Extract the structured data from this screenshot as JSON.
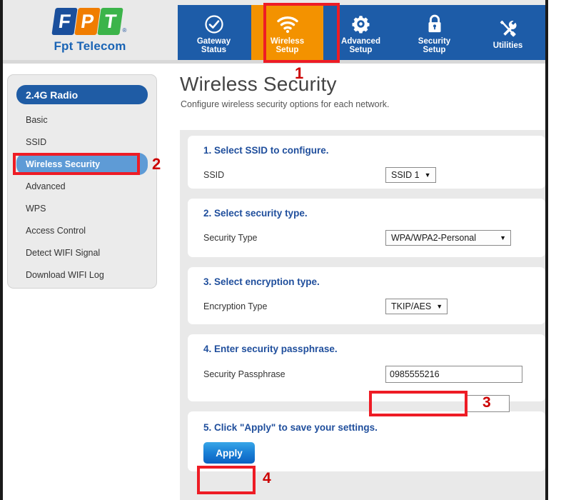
{
  "brand": {
    "letters": [
      "F",
      "P",
      "T"
    ],
    "registered": "®",
    "name": "Fpt Telecom"
  },
  "nav": {
    "items": [
      {
        "id": "gateway-status",
        "line1": "Gateway",
        "line2": "Status",
        "icon": "check-circle-icon",
        "active": false
      },
      {
        "id": "wireless-setup",
        "line1": "Wireless",
        "line2": "Setup",
        "icon": "wifi-icon",
        "active": true
      },
      {
        "id": "advanced-setup",
        "line1": "Advanced",
        "line2": "Setup",
        "icon": "gear-icon",
        "active": false
      },
      {
        "id": "security-setup",
        "line1": "Security",
        "line2": "Setup",
        "icon": "lock-icon",
        "active": false
      },
      {
        "id": "utilities",
        "line1": "Utilities",
        "line2": "",
        "icon": "tools-icon",
        "active": false
      }
    ]
  },
  "sidebar": {
    "header": "2.4G Radio",
    "items": [
      {
        "label": "Basic",
        "selected": false
      },
      {
        "label": "SSID",
        "selected": false
      },
      {
        "label": "Wireless Security",
        "selected": true
      },
      {
        "label": "Advanced",
        "selected": false
      },
      {
        "label": "WPS",
        "selected": false
      },
      {
        "label": "Access Control",
        "selected": false
      },
      {
        "label": "Detect WIFI Signal",
        "selected": false
      },
      {
        "label": "Download WIFI Log",
        "selected": false
      }
    ]
  },
  "main": {
    "title": "Wireless Security",
    "subtitle": "Configure wireless security options for each network.",
    "sections": {
      "ssid": {
        "title": "1. Select SSID to configure.",
        "label": "SSID",
        "value": "SSID 1"
      },
      "security_type": {
        "title": "2. Select security type.",
        "label": "Security Type",
        "value": "WPA/WPA2-Personal"
      },
      "encryption_type": {
        "title": "3. Select encryption type.",
        "label": "Encryption Type",
        "value": "TKIP/AES"
      },
      "passphrase": {
        "title": "4. Enter security passphrase.",
        "label": "Security Passphrase",
        "value": "0985555216",
        "placeholder": ""
      },
      "apply": {
        "title": "5. Click \"Apply\" to save your settings.",
        "button_label": "Apply"
      }
    }
  },
  "annotations": {
    "step1": "1",
    "step2": "2",
    "step3": "3",
    "step4": "4",
    "color": "#ee1c25",
    "number_color": "#cc0000"
  },
  "colors": {
    "nav_background": "#1d5ca8",
    "nav_active": "#f39200",
    "sidebar_header": "#1f5ca5",
    "sidebar_selected": "#5e9bd6",
    "section_title": "#1f4e9c",
    "panel_area": "#e9e9e9",
    "brand_blue": "#1a4f9c",
    "brand_orange": "#f07d00",
    "brand_green": "#3cb44a"
  }
}
